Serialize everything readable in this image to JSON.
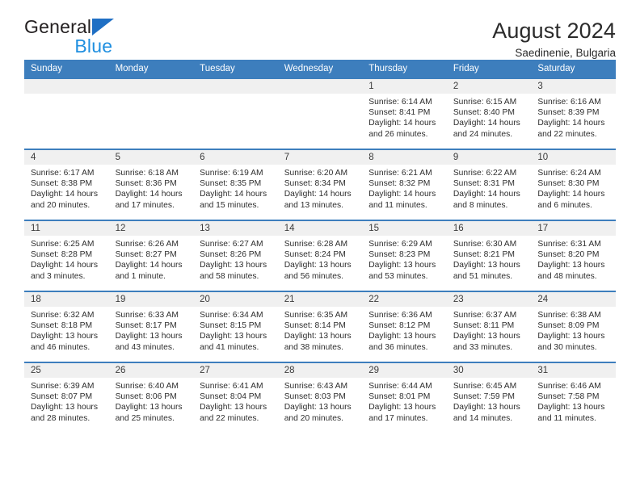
{
  "brand": {
    "name_part1": "General",
    "name_part2": "Blue",
    "mark": "triangle-logo",
    "color_dark": "#231f20",
    "color_blue": "#1f8fe0",
    "mark_color": "#1f6fc4"
  },
  "header": {
    "title": "August 2024",
    "subtitle": "Saedinenie, Bulgaria"
  },
  "theme": {
    "header_bar": "#3d7ebd",
    "row_rule": "#3d7ebd",
    "daynum_strip": "#f0f0f0",
    "text": "#2e2e2e"
  },
  "weekdays": [
    "Sunday",
    "Monday",
    "Tuesday",
    "Wednesday",
    "Thursday",
    "Friday",
    "Saturday"
  ],
  "weeks": [
    [
      {
        "day": "",
        "sunrise": "",
        "sunset": "",
        "daylight_line1": "",
        "daylight_line2": "",
        "empty": true
      },
      {
        "day": "",
        "sunrise": "",
        "sunset": "",
        "daylight_line1": "",
        "daylight_line2": "",
        "empty": true
      },
      {
        "day": "",
        "sunrise": "",
        "sunset": "",
        "daylight_line1": "",
        "daylight_line2": "",
        "empty": true
      },
      {
        "day": "",
        "sunrise": "",
        "sunset": "",
        "daylight_line1": "",
        "daylight_line2": "",
        "empty": true
      },
      {
        "day": "1",
        "sunrise": "Sunrise: 6:14 AM",
        "sunset": "Sunset: 8:41 PM",
        "daylight_line1": "Daylight: 14 hours",
        "daylight_line2": "and 26 minutes.",
        "empty": false
      },
      {
        "day": "2",
        "sunrise": "Sunrise: 6:15 AM",
        "sunset": "Sunset: 8:40 PM",
        "daylight_line1": "Daylight: 14 hours",
        "daylight_line2": "and 24 minutes.",
        "empty": false
      },
      {
        "day": "3",
        "sunrise": "Sunrise: 6:16 AM",
        "sunset": "Sunset: 8:39 PM",
        "daylight_line1": "Daylight: 14 hours",
        "daylight_line2": "and 22 minutes.",
        "empty": false
      }
    ],
    [
      {
        "day": "4",
        "sunrise": "Sunrise: 6:17 AM",
        "sunset": "Sunset: 8:38 PM",
        "daylight_line1": "Daylight: 14 hours",
        "daylight_line2": "and 20 minutes.",
        "empty": false
      },
      {
        "day": "5",
        "sunrise": "Sunrise: 6:18 AM",
        "sunset": "Sunset: 8:36 PM",
        "daylight_line1": "Daylight: 14 hours",
        "daylight_line2": "and 17 minutes.",
        "empty": false
      },
      {
        "day": "6",
        "sunrise": "Sunrise: 6:19 AM",
        "sunset": "Sunset: 8:35 PM",
        "daylight_line1": "Daylight: 14 hours",
        "daylight_line2": "and 15 minutes.",
        "empty": false
      },
      {
        "day": "7",
        "sunrise": "Sunrise: 6:20 AM",
        "sunset": "Sunset: 8:34 PM",
        "daylight_line1": "Daylight: 14 hours",
        "daylight_line2": "and 13 minutes.",
        "empty": false
      },
      {
        "day": "8",
        "sunrise": "Sunrise: 6:21 AM",
        "sunset": "Sunset: 8:32 PM",
        "daylight_line1": "Daylight: 14 hours",
        "daylight_line2": "and 11 minutes.",
        "empty": false
      },
      {
        "day": "9",
        "sunrise": "Sunrise: 6:22 AM",
        "sunset": "Sunset: 8:31 PM",
        "daylight_line1": "Daylight: 14 hours",
        "daylight_line2": "and 8 minutes.",
        "empty": false
      },
      {
        "day": "10",
        "sunrise": "Sunrise: 6:24 AM",
        "sunset": "Sunset: 8:30 PM",
        "daylight_line1": "Daylight: 14 hours",
        "daylight_line2": "and 6 minutes.",
        "empty": false
      }
    ],
    [
      {
        "day": "11",
        "sunrise": "Sunrise: 6:25 AM",
        "sunset": "Sunset: 8:28 PM",
        "daylight_line1": "Daylight: 14 hours",
        "daylight_line2": "and 3 minutes.",
        "empty": false
      },
      {
        "day": "12",
        "sunrise": "Sunrise: 6:26 AM",
        "sunset": "Sunset: 8:27 PM",
        "daylight_line1": "Daylight: 14 hours",
        "daylight_line2": "and 1 minute.",
        "empty": false
      },
      {
        "day": "13",
        "sunrise": "Sunrise: 6:27 AM",
        "sunset": "Sunset: 8:26 PM",
        "daylight_line1": "Daylight: 13 hours",
        "daylight_line2": "and 58 minutes.",
        "empty": false
      },
      {
        "day": "14",
        "sunrise": "Sunrise: 6:28 AM",
        "sunset": "Sunset: 8:24 PM",
        "daylight_line1": "Daylight: 13 hours",
        "daylight_line2": "and 56 minutes.",
        "empty": false
      },
      {
        "day": "15",
        "sunrise": "Sunrise: 6:29 AM",
        "sunset": "Sunset: 8:23 PM",
        "daylight_line1": "Daylight: 13 hours",
        "daylight_line2": "and 53 minutes.",
        "empty": false
      },
      {
        "day": "16",
        "sunrise": "Sunrise: 6:30 AM",
        "sunset": "Sunset: 8:21 PM",
        "daylight_line1": "Daylight: 13 hours",
        "daylight_line2": "and 51 minutes.",
        "empty": false
      },
      {
        "day": "17",
        "sunrise": "Sunrise: 6:31 AM",
        "sunset": "Sunset: 8:20 PM",
        "daylight_line1": "Daylight: 13 hours",
        "daylight_line2": "and 48 minutes.",
        "empty": false
      }
    ],
    [
      {
        "day": "18",
        "sunrise": "Sunrise: 6:32 AM",
        "sunset": "Sunset: 8:18 PM",
        "daylight_line1": "Daylight: 13 hours",
        "daylight_line2": "and 46 minutes.",
        "empty": false
      },
      {
        "day": "19",
        "sunrise": "Sunrise: 6:33 AM",
        "sunset": "Sunset: 8:17 PM",
        "daylight_line1": "Daylight: 13 hours",
        "daylight_line2": "and 43 minutes.",
        "empty": false
      },
      {
        "day": "20",
        "sunrise": "Sunrise: 6:34 AM",
        "sunset": "Sunset: 8:15 PM",
        "daylight_line1": "Daylight: 13 hours",
        "daylight_line2": "and 41 minutes.",
        "empty": false
      },
      {
        "day": "21",
        "sunrise": "Sunrise: 6:35 AM",
        "sunset": "Sunset: 8:14 PM",
        "daylight_line1": "Daylight: 13 hours",
        "daylight_line2": "and 38 minutes.",
        "empty": false
      },
      {
        "day": "22",
        "sunrise": "Sunrise: 6:36 AM",
        "sunset": "Sunset: 8:12 PM",
        "daylight_line1": "Daylight: 13 hours",
        "daylight_line2": "and 36 minutes.",
        "empty": false
      },
      {
        "day": "23",
        "sunrise": "Sunrise: 6:37 AM",
        "sunset": "Sunset: 8:11 PM",
        "daylight_line1": "Daylight: 13 hours",
        "daylight_line2": "and 33 minutes.",
        "empty": false
      },
      {
        "day": "24",
        "sunrise": "Sunrise: 6:38 AM",
        "sunset": "Sunset: 8:09 PM",
        "daylight_line1": "Daylight: 13 hours",
        "daylight_line2": "and 30 minutes.",
        "empty": false
      }
    ],
    [
      {
        "day": "25",
        "sunrise": "Sunrise: 6:39 AM",
        "sunset": "Sunset: 8:07 PM",
        "daylight_line1": "Daylight: 13 hours",
        "daylight_line2": "and 28 minutes.",
        "empty": false
      },
      {
        "day": "26",
        "sunrise": "Sunrise: 6:40 AM",
        "sunset": "Sunset: 8:06 PM",
        "daylight_line1": "Daylight: 13 hours",
        "daylight_line2": "and 25 minutes.",
        "empty": false
      },
      {
        "day": "27",
        "sunrise": "Sunrise: 6:41 AM",
        "sunset": "Sunset: 8:04 PM",
        "daylight_line1": "Daylight: 13 hours",
        "daylight_line2": "and 22 minutes.",
        "empty": false
      },
      {
        "day": "28",
        "sunrise": "Sunrise: 6:43 AM",
        "sunset": "Sunset: 8:03 PM",
        "daylight_line1": "Daylight: 13 hours",
        "daylight_line2": "and 20 minutes.",
        "empty": false
      },
      {
        "day": "29",
        "sunrise": "Sunrise: 6:44 AM",
        "sunset": "Sunset: 8:01 PM",
        "daylight_line1": "Daylight: 13 hours",
        "daylight_line2": "and 17 minutes.",
        "empty": false
      },
      {
        "day": "30",
        "sunrise": "Sunrise: 6:45 AM",
        "sunset": "Sunset: 7:59 PM",
        "daylight_line1": "Daylight: 13 hours",
        "daylight_line2": "and 14 minutes.",
        "empty": false
      },
      {
        "day": "31",
        "sunrise": "Sunrise: 6:46 AM",
        "sunset": "Sunset: 7:58 PM",
        "daylight_line1": "Daylight: 13 hours",
        "daylight_line2": "and 11 minutes.",
        "empty": false
      }
    ]
  ]
}
